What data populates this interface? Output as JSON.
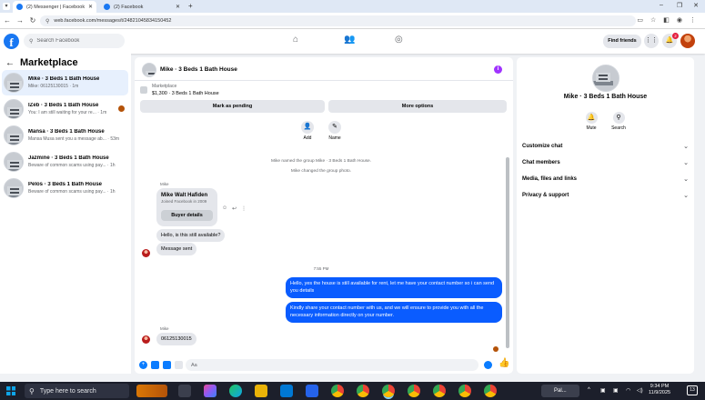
{
  "browser": {
    "tabs": [
      {
        "title": "(2) Messenger | Facebook",
        "active": true
      },
      {
        "title": "(2) Facebook",
        "active": false
      }
    ],
    "url": "web.facebook.com/messages/t/24821045834150452"
  },
  "header": {
    "search_placeholder": "Search Facebook",
    "find_friends": "Find friends",
    "notification_count": "2"
  },
  "left": {
    "title": "Marketplace",
    "conversations": [
      {
        "name": "Mike · 3 Beds 1 Bath House",
        "preview": "Mike: 06125130015 · 1m",
        "active": true
      },
      {
        "name": "IZeb · 3 Beds 1 Bath House",
        "preview": "You: I am still waiting for your re... · 1m",
        "active": false
      },
      {
        "name": "Mansa · 3 Beds 1 Bath House",
        "preview": "Mansa Musa sent you a message ab... · 53m",
        "active": false
      },
      {
        "name": "Jazmine · 3 Beds 1 Bath House",
        "preview": "Beware of common scams using pay... · 1h",
        "active": false
      },
      {
        "name": "Pelos · 3 Beds 1 Bath House",
        "preview": "Beware of common scams using pay... · 1h",
        "active": false
      }
    ]
  },
  "chat": {
    "title": "Mike · 3 Beds 1 Bath House",
    "marketplace_label": "Marketplace",
    "listing": "$1,300 · 3 Beds 1 Bath House",
    "mark_pending": "Mark as pending",
    "more_options": "More options",
    "add_label": "Add",
    "name_label": "Name",
    "system1": "Mike named the group Mike · 3 Beds 1 Bath House.",
    "system2": "Mike changed the group photo.",
    "sender1": "Mike",
    "card_name": "Mike Walt Hafiden",
    "card_sub": "Joined Facebook in 2009",
    "buyer_details": "Buyer details",
    "msg_in1": "Hello, is this still available?",
    "msg_in2": "Message sent",
    "timestamp": "7:55 PM",
    "msg_out1": "Hello, yes the house is still available for rent, let me have your contact number so i can send you  details",
    "msg_out2": "Kindly share your contact number with us, and we will ensure to provide you with all the necessary information directly on your number.",
    "sender2": "Mike",
    "msg_in3": "06125130015",
    "composer_placeholder": "Aa"
  },
  "right": {
    "name": "Mike · 3 Beds 1 Bath House",
    "mute": "Mute",
    "search": "Search",
    "sections": [
      "Customize chat",
      "Chat members",
      "Media, files and links",
      "Privacy & support"
    ]
  },
  "taskbar": {
    "search": "Type here to search",
    "pinned_label": "Pal...",
    "time": "9:34 PM",
    "date": "11/9/2025",
    "notifications": "13"
  },
  "colors": {
    "brand": "#1877f2",
    "outgoing_bubble": "#0a5cff",
    "incoming_bubble": "#e4e6eb",
    "info_accent": "#a033ff"
  }
}
